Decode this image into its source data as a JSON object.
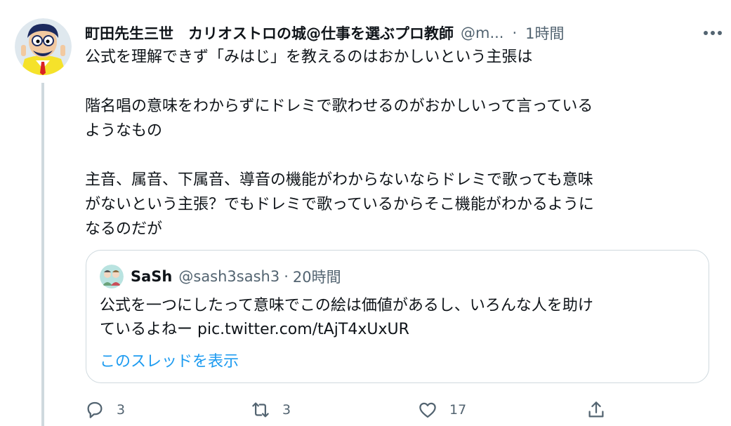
{
  "tweet": {
    "author": {
      "display_name": "町田先生三世　カリオストロの城@仕事を選ぶプロ教師",
      "handle": "@m...",
      "avatar_icon": "cartoon-man-avatar"
    },
    "separator": "·",
    "time": "1時間",
    "text": "公式を理解できず「みはじ」を教えるのはおかしいという主張は\n\n階名唱の意味をわからずにドレミで歌わせるのがおかしいって言っている\nようなもの\n\n主音、属音、下属音、導音の機能がわからないならドレミで歌っても意味\nがないという主張？でもドレミで歌っているからそこ機能がわかるように\nなるのだが",
    "quoted": {
      "display_name": "SaSh",
      "handle": "@sash3sash3",
      "separator": "·",
      "time": "20時間",
      "text": "公式を一つにしたって意味でこの絵は価値があるし、いろんな人を助け\nているよねー ",
      "link": "pic.twitter.com/tAjT4xUxUR",
      "show_thread": "このスレッドを表示"
    },
    "actions": {
      "reply_count": "3",
      "retweet_count": "3",
      "like_count": "17"
    }
  },
  "colors": {
    "text": "#0f1419",
    "secondary": "#536471",
    "link": "#1d9bf0",
    "border": "#cfd9de",
    "avatar_yellow": "#f5e22a"
  }
}
